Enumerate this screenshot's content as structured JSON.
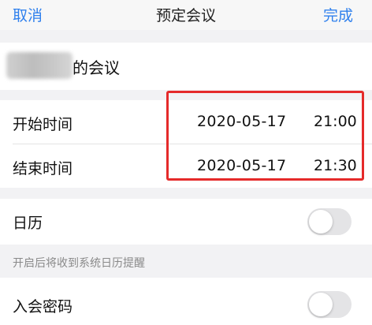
{
  "navbar": {
    "cancel_label": "取消",
    "title": "预定会议",
    "done_label": "完成"
  },
  "subject": {
    "visible_text": "的会议"
  },
  "time": {
    "start_label": "开始时间",
    "start_date": "2020-05-17",
    "start_time": "21:00",
    "end_label": "结束时间",
    "end_date": "2020-05-17",
    "end_time": "21:30"
  },
  "calendar": {
    "label": "日历",
    "toggle_on": false,
    "hint": "开启后将收到系统日历提醒"
  },
  "password": {
    "label": "入会密码",
    "toggle_on": false
  },
  "colors": {
    "accent": "#2f80ed",
    "highlight": "#e52a2a"
  }
}
